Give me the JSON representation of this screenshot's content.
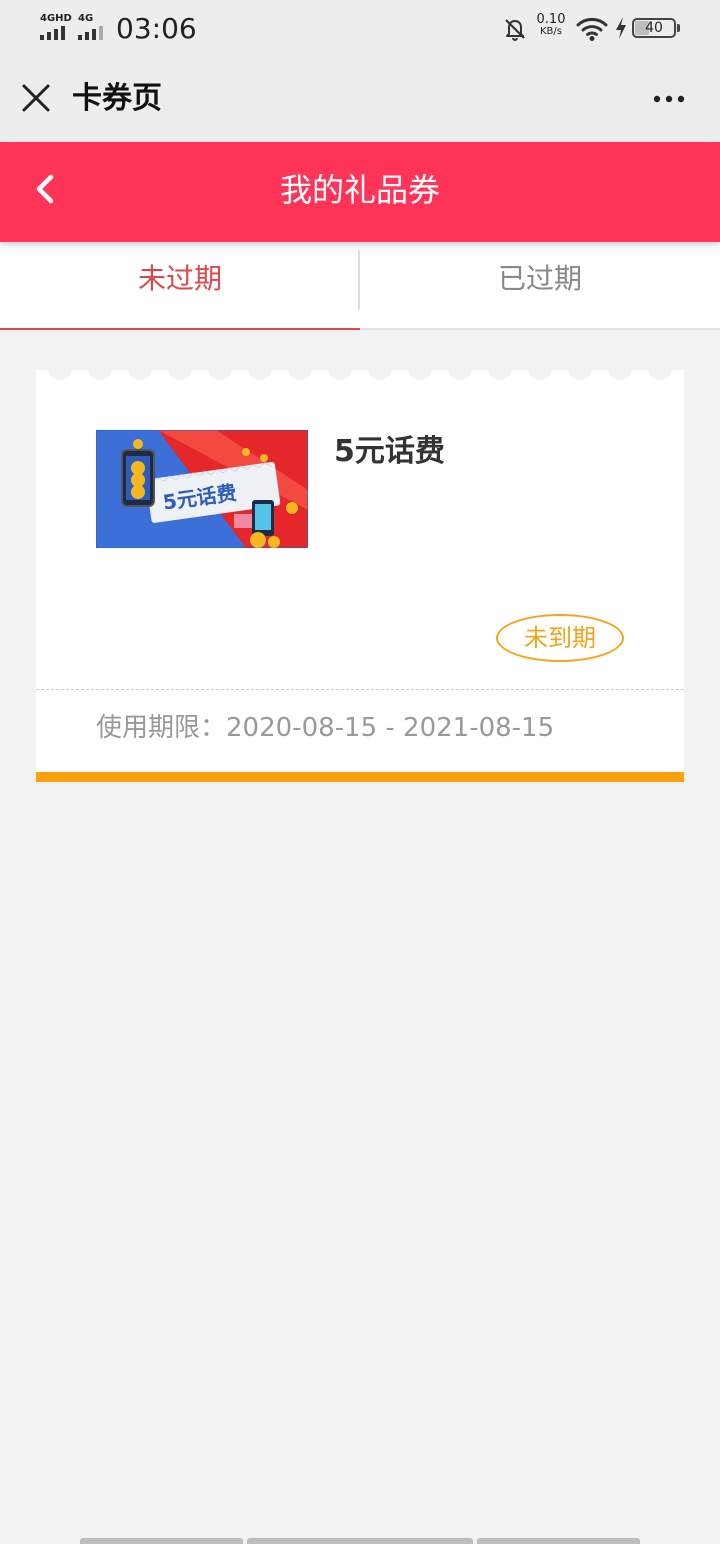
{
  "status_bar": {
    "signal1_label": "4GHD",
    "signal2_label": "4G",
    "time": "03:06",
    "net_speed_value": "0.10",
    "net_speed_unit": "KB/s",
    "battery_level": "40",
    "icons": [
      "signal-icon",
      "mute-bell-icon",
      "wifi-icon",
      "charging-bolt-icon",
      "battery-icon"
    ]
  },
  "title_bar": {
    "title": "卡券页",
    "icons": [
      "close-icon",
      "more-dots-icon"
    ]
  },
  "header": {
    "title": "我的礼品券",
    "color": "#ff3458",
    "icons": [
      "chevron-left-icon"
    ]
  },
  "tabs": [
    {
      "label": "未过期",
      "active": true
    },
    {
      "label": "已过期",
      "active": false
    }
  ],
  "coupon": {
    "thumbnail_text": "5元话费",
    "name": "5元话费",
    "status": "未到期",
    "validity_label": "使用期限：",
    "validity_range": "2020-08-15 - 2021-08-15",
    "accent_color": "#f7a10d"
  },
  "colors": {
    "brand_red": "#ff3458",
    "tab_active": "#d9484d",
    "badge_orange": "#f0a41c",
    "background": "#f2f2f2"
  }
}
